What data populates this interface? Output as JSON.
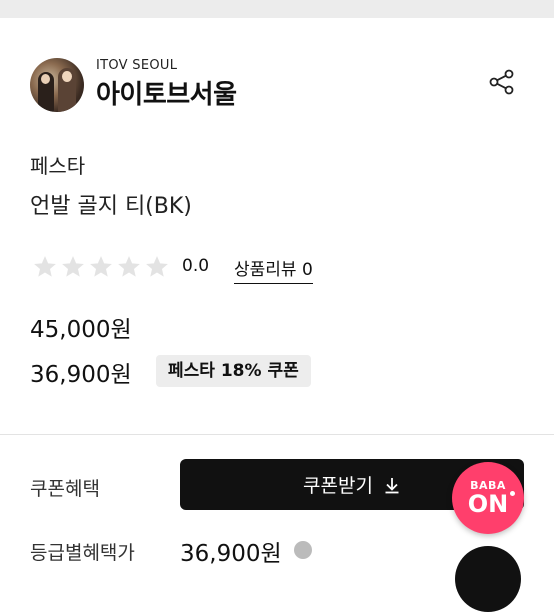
{
  "store": {
    "name_en": "ITOV SEOUL",
    "name_kr": "아이토브서울"
  },
  "product": {
    "vendor": "페스타",
    "name": "언발 골지 티(BK)"
  },
  "rating": {
    "score": "0.0",
    "stars_filled": 0,
    "stars_total": 5,
    "review_text": "상품리뷰 0"
  },
  "price": {
    "original": "45,000원",
    "sale": "36,900원",
    "coupon_badge": "페스타 18% 쿠폰"
  },
  "benefits": {
    "coupon_label": "쿠폰혜택",
    "coupon_button": "쿠폰받기",
    "grade_label": "등급별혜택가",
    "grade_price": "36,900원"
  },
  "fab": {
    "line1": "BABA",
    "line2": "ON",
    "color": "#ff3f6c"
  },
  "icons": {
    "share": "share-icon",
    "download": "download-arrow-icon",
    "star": "star-icon"
  }
}
